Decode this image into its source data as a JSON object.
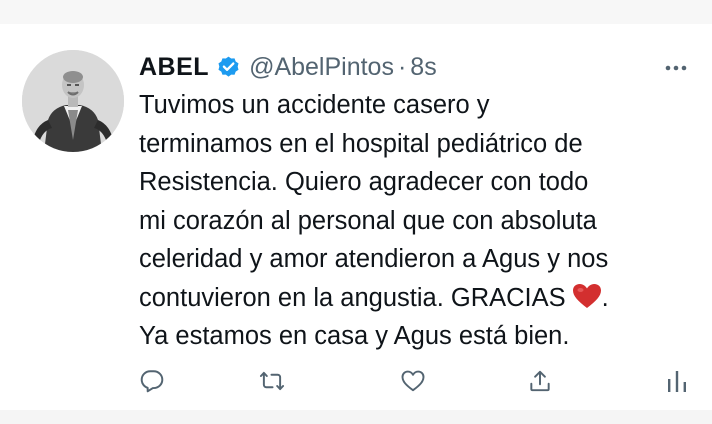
{
  "tweet": {
    "display_name": "ABEL",
    "handle": "@AbelPintos",
    "separator": "·",
    "time": "8s",
    "verified": true,
    "lines": [
      "Tuvimos un accidente casero y",
      "terminamos en el hospital pediátrico de",
      "Resistencia. Quiero agradecer con todo",
      "mi corazón al personal que con absoluta",
      "celeridad y amor atendieron a Agus y nos",
      "contuvieron en la angustia. GRACIAS",
      "Ya estamos en casa y Agus está bien."
    ],
    "line6_suffix": ".",
    "emoji": "red-heart",
    "actions": [
      "reply-icon",
      "retweet-icon",
      "like-icon",
      "share-icon",
      "analytics-icon"
    ]
  },
  "colors": {
    "text": "#0f1419",
    "secondary": "#536471",
    "verified_blue": "#1d9bf0",
    "heart_red": "#d32f2f"
  }
}
